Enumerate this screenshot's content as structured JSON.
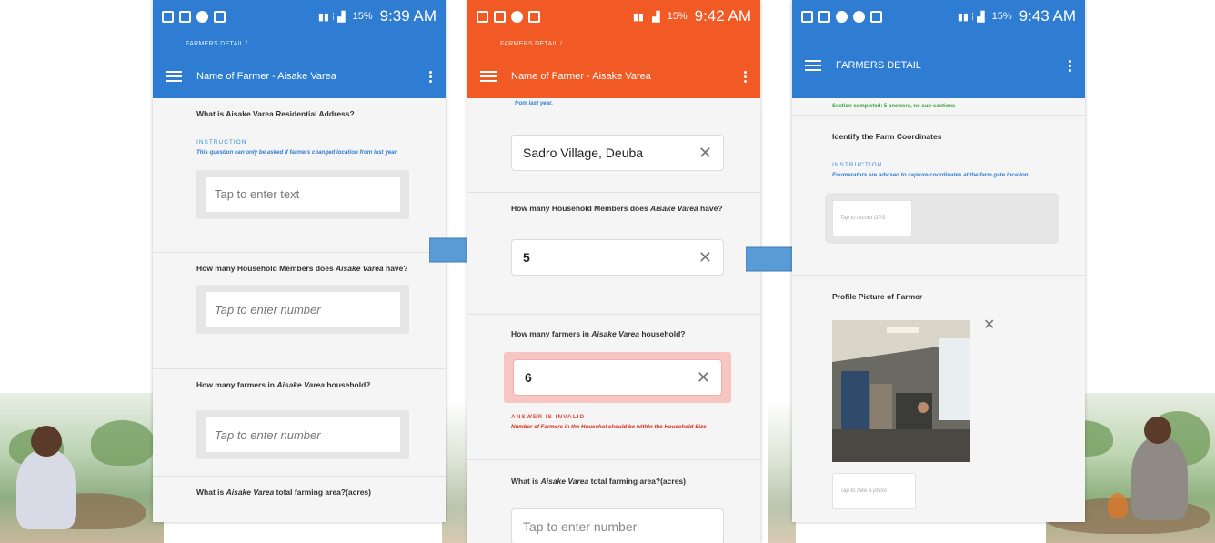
{
  "screens": [
    {
      "status": {
        "time": "9:39 AM",
        "battery": "15%"
      },
      "breadcrumb": "FARMERS DETAIL /",
      "title": "Name of Farmer - Aisake Varea",
      "q1": {
        "text": "What is Aisake Varea Residential Address?",
        "instruction_label": "INSTRUCTION",
        "instruction": "This question can only be asked if farmers changed location from last year.",
        "placeholder": "Tap to enter text"
      },
      "q2": {
        "text_a": "How many Household Members does ",
        "name": "Aisake Varea",
        "text_b": " have?",
        "placeholder": "Tap to enter number"
      },
      "q3": {
        "text_a": "How many farmers in ",
        "name": "Aisake Varea",
        "text_b": " household?",
        "placeholder": "Tap to enter number"
      },
      "q4": {
        "text_a": "What is ",
        "name": "Aisake Varea",
        "text_b": " total farming area?(acres)"
      }
    },
    {
      "status": {
        "time": "9:42 AM",
        "battery": "15%"
      },
      "breadcrumb": "FARMERS DETAIL /",
      "title": "Name of Farmer - Aisake Varea",
      "q1": {
        "instruction_tail": "from last year.",
        "answer": "Sadro Village, Deuba"
      },
      "q2": {
        "text_a": "How many Household Members does ",
        "name": "Aisake Varea",
        "text_b": " have?",
        "answer": "5"
      },
      "q3": {
        "text_a": "How many farmers in ",
        "name": "Aisake Varea",
        "text_b": " household?",
        "answer": "6",
        "error_label": "ANSWER IS INVALID",
        "error": "Number of Farmers in the Househol should be within the Household Size"
      },
      "q4": {
        "text_a": "What is ",
        "name": "Aisake Varea",
        "text_b": " total farming area?(acres)",
        "placeholder": "Tap to enter number"
      }
    },
    {
      "status": {
        "time": "9:43 AM",
        "battery": "15%"
      },
      "title": "FARMERS DETAIL",
      "section_done": "Section completed: 5 answers, no sub-sections",
      "q1": {
        "text": "Identify the Farm Coordinates",
        "instruction_label": "INSTRUCTION",
        "instruction": "Enumerators are advised to capture coordinates at the farm gate location.",
        "button": "Tap to record GPS"
      },
      "q2": {
        "text": "Profile Picture of Farmer",
        "button": "Tap to take a photo"
      }
    }
  ],
  "colors": {
    "blue": "#2f7dd3",
    "orange": "#f15a24",
    "arrow": "#5b9bd5"
  },
  "icons": [
    "menu-icon",
    "more-vert-icon",
    "close-icon",
    "arrow-right-icon"
  ]
}
